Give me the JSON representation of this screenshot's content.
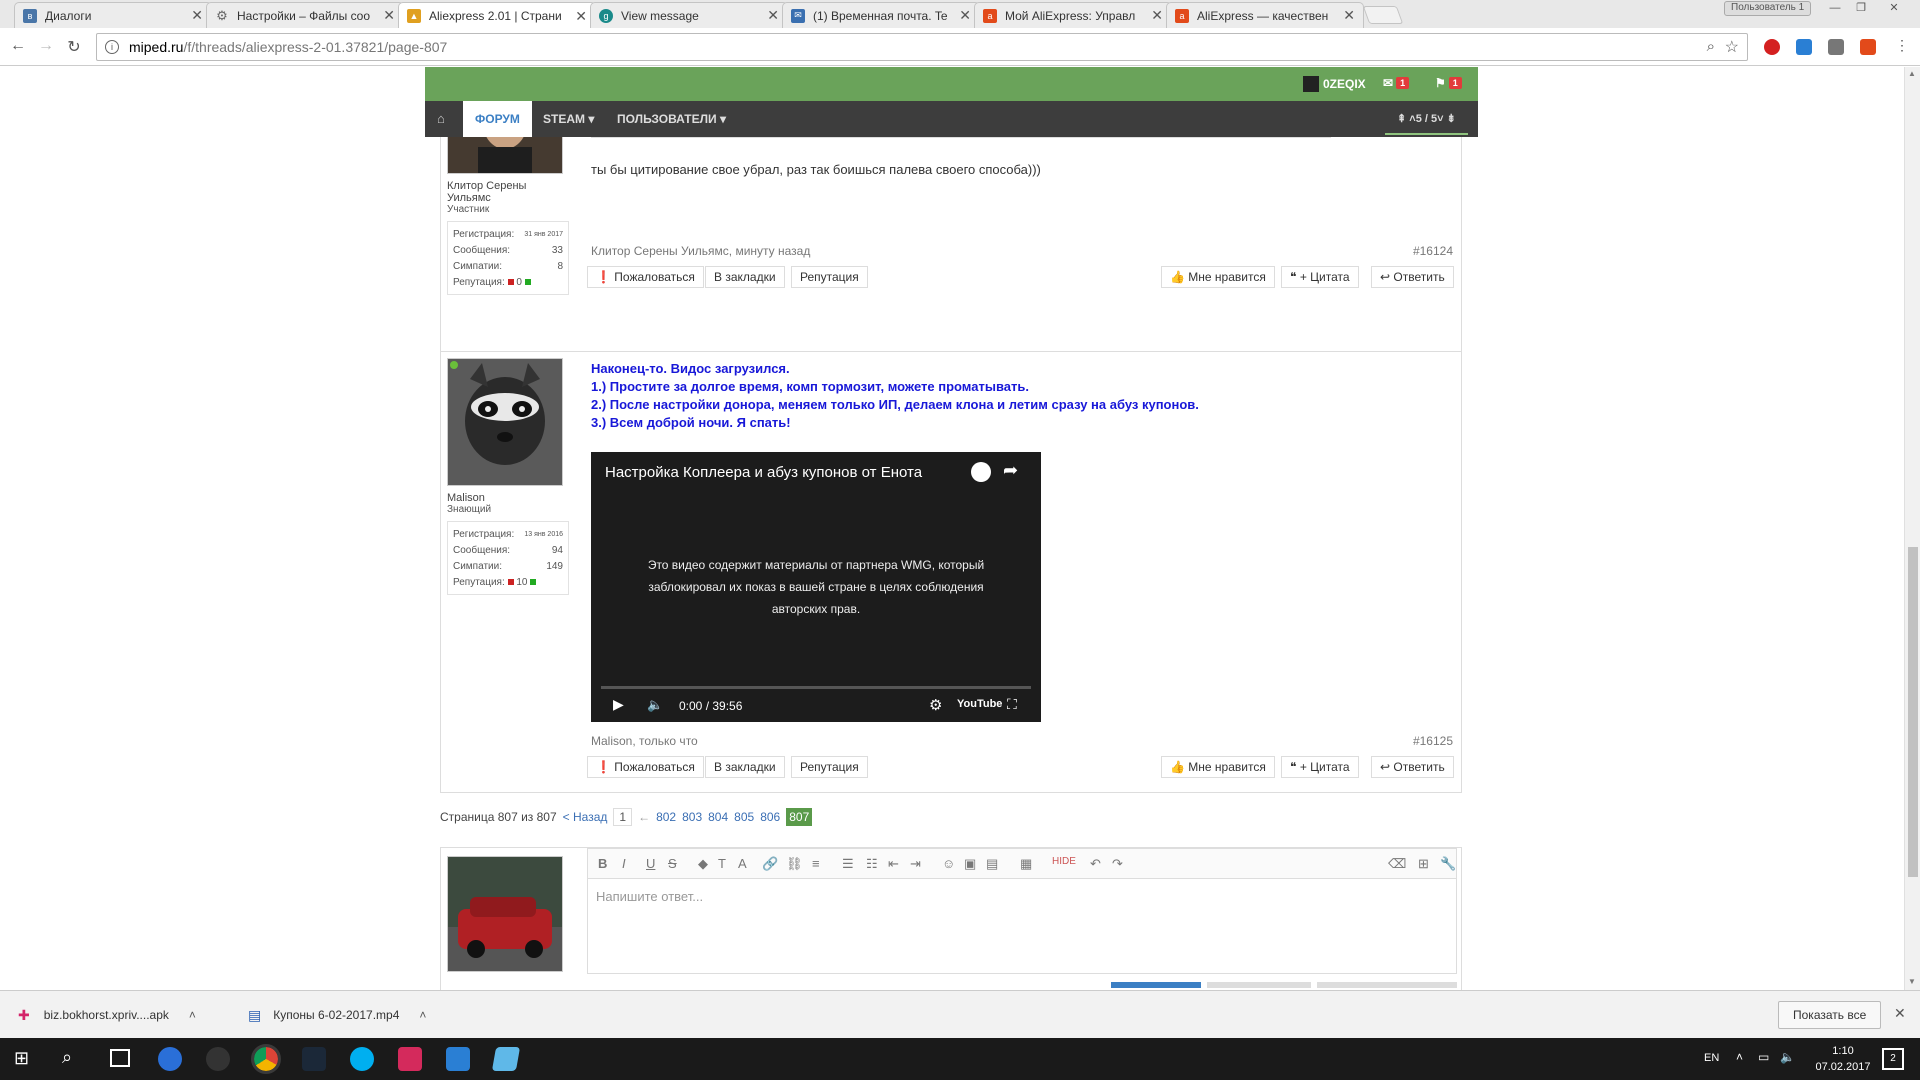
{
  "browser": {
    "tabs": [
      {
        "title": "Диалоги",
        "favicon": "vk-icon",
        "color": "#4a76a8"
      },
      {
        "title": "Настройки – Файлы coo",
        "favicon": "gear-icon",
        "color": "#666666"
      },
      {
        "title": "Aliexpress 2.01 | Страни",
        "favicon": "miped-icon",
        "color": "#e0a020"
      },
      {
        "title": "View message",
        "favicon": "globe-icon",
        "color": "#1a8a8a"
      },
      {
        "title": "(1) Временная почта. Te",
        "favicon": "mail-icon",
        "color": "#3a6fb0"
      },
      {
        "title": "Мой AliExpress: Управл",
        "favicon": "aliexpress-icon",
        "color": "#e24a1a"
      },
      {
        "title": "AliExpress — качествен",
        "favicon": "aliexpress-icon",
        "color": "#e24a1a"
      }
    ],
    "user_badge": "Пользователь 1",
    "url_host": "miped.ru",
    "url_path": "/f/threads/aliexpress-2-01.37821/page-807"
  },
  "forum": {
    "username": "0ZEQIX",
    "mail_count": "1",
    "alert_count": "1",
    "nav": {
      "forum": "ФОРУМ",
      "steam": "STEAM",
      "users": "ПОЛЬЗОВАТЕЛИ"
    },
    "page_nav": "5 / 5"
  },
  "posts": [
    {
      "username": "Клитор Серены Уильямс",
      "user_title": "Участник",
      "stats": {
        "reg_label": "Регистрация:",
        "reg": "31 янв 2017",
        "msgs_label": "Сообщения:",
        "msgs": "33",
        "likes_label": "Симпатии:",
        "likes": "8",
        "rep_label": "Репутация:",
        "rep": "0"
      },
      "quote_tail": ")",
      "text": "ты бы цитирование свое убрал, раз так боишься палева своего способа)))",
      "meta": "Клитор Серены Уильямс, минуту назад",
      "number": "#16124"
    },
    {
      "username": "Malison",
      "user_title": "Знающий",
      "stats": {
        "reg_label": "Регистрация:",
        "reg": "13 янв 2016",
        "msgs_label": "Сообщения:",
        "msgs": "94",
        "likes_label": "Симпатии:",
        "likes": "149",
        "rep_label": "Репутация:",
        "rep": "10"
      },
      "lines": [
        "Наконец-то. Видос загрузился.",
        "1.) Простите за долгое время, комп тормозит, можете проматывать.",
        "2.) После настройки донора, меняем только ИП, делаем клона и летим сразу на абуз купонов.",
        "3.) Всем доброй ночи. Я спать!"
      ],
      "video": {
        "title": "Настройка Коплеера и абуз купонов от Енота",
        "blocked_msg": "Это видео содержит материалы от партнера WMG, который заблокировал их показ в вашей стране в целях соблюдения авторских прав.",
        "time": "0:00 / 39:56",
        "logo": "YouTube"
      },
      "meta": "Malison, только что",
      "number": "#16125"
    }
  ],
  "post_actions": {
    "report": "Пожаловаться",
    "bookmark": "В закладки",
    "reputation": "Репутация",
    "like": "Мне нравится",
    "quote": "+ Цитата",
    "reply": "Ответить"
  },
  "pagination": {
    "label": "Страница 807 из 807",
    "prev": "< Назад",
    "first": "1",
    "ellipsis": "←",
    "pages": [
      "802",
      "803",
      "804",
      "805",
      "806"
    ],
    "current": "807"
  },
  "editor": {
    "placeholder": "Напишите ответ...",
    "hide_label": "HIDE"
  },
  "downloads": {
    "items": [
      "biz.bokhorst.xpriv....apk",
      "Купоны 6-02-2017.mp4"
    ],
    "show_all": "Показать все"
  },
  "taskbar": {
    "lang": "EN",
    "time": "1:10",
    "date": "07.02.2017",
    "notif_count": "2"
  }
}
